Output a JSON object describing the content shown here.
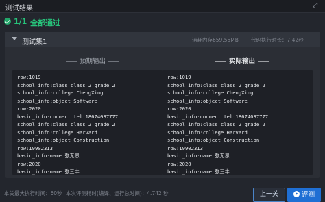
{
  "window": {
    "title": "测试结果"
  },
  "summary": {
    "count": "1/1",
    "status": "全部通过",
    "status_color": "#27c27a"
  },
  "case": {
    "name": "测试集1",
    "memory": "消耗内存659.55MB",
    "time": "代码执行时长：7.42秒"
  },
  "expected": {
    "title": "预期输出",
    "lines": [
      "row:1019",
      "school_info:class class 2 grade 2",
      "school_info:college ChengXing",
      "school_info:object Software",
      "row:2020",
      "basic_info:connect tel:18674037777",
      "school_info:class class 2 grade 2",
      "school_info:college Harvard",
      "school_info:object Construction",
      "row:19902313",
      "basic_info:name 张无忌",
      "row:2020",
      "basic_info:name 张三丰"
    ]
  },
  "actual": {
    "title": "实际输出",
    "lines": [
      "row:1019",
      "school_info:class class 2 grade 2",
      "school_info:college ChengXing",
      "school_info:object Software",
      "row:2020",
      "basic_info:connect tel:18674037777",
      "school_info:class class 2 grade 2",
      "school_info:college Harvard",
      "school_info:object Construction",
      "row:19902313",
      "basic_info:name 张无忌",
      "row:2020",
      "basic_info:name 张三丰"
    ]
  },
  "footer": {
    "max_time": "本关最大执行时间：60秒",
    "this_time": "本次评测耗时(编译、运行总时间)：4.742 秒",
    "prev_button": "上一关",
    "eval_button": "评测"
  }
}
